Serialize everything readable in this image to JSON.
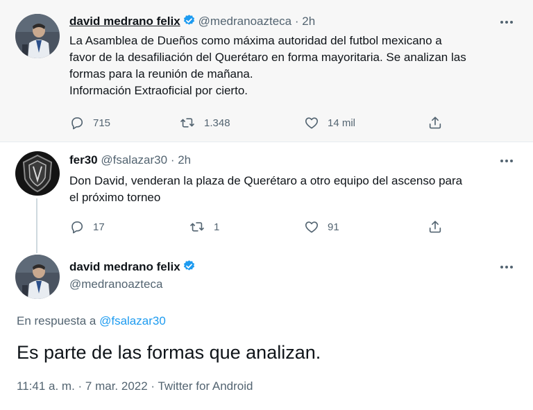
{
  "tweet1": {
    "name": "david medrano felix",
    "handle": "@medranoazteca",
    "separator": "·",
    "time": "2h",
    "text_lines": [
      "La Asamblea de Dueños como máxima autoridad del futbol mexicano a",
      "favor de la desafiliación del Querétaro en forma mayoritaria. Se analizan las",
      "formas para la reunión de mañana.",
      "Información Extraoficial por cierto."
    ],
    "replies": "715",
    "retweets": "1.348",
    "likes": "14 mil"
  },
  "tweet2": {
    "name": "fer30",
    "handle": "@fsalazar30",
    "separator": "·",
    "time": "2h",
    "text_lines": [
      "Don David, venderan la plaza de Querétaro a otro equipo del ascenso para",
      "el próximo torneo"
    ],
    "replies": "17",
    "retweets": "1",
    "likes": "91"
  },
  "tweet3": {
    "name": "david medrano felix",
    "handle": "@medranoazteca",
    "reply_prefix": "En respuesta a",
    "reply_mention": "@fsalazar30",
    "text": "Es parte de las formas que analizan.",
    "meta": "11:41 a. m. · 7 mar. 2022 · Twitter for Android"
  },
  "icons": {
    "verified": "verified-badge-icon",
    "more": "more-dots-icon",
    "reply": "reply-bubble-icon",
    "retweet": "retweet-icon",
    "like": "heart-icon",
    "share": "share-upload-icon"
  },
  "colors": {
    "accent": "#1d9bf0",
    "secondary_text": "#536471",
    "highlight_background": "#f7f7f7"
  }
}
